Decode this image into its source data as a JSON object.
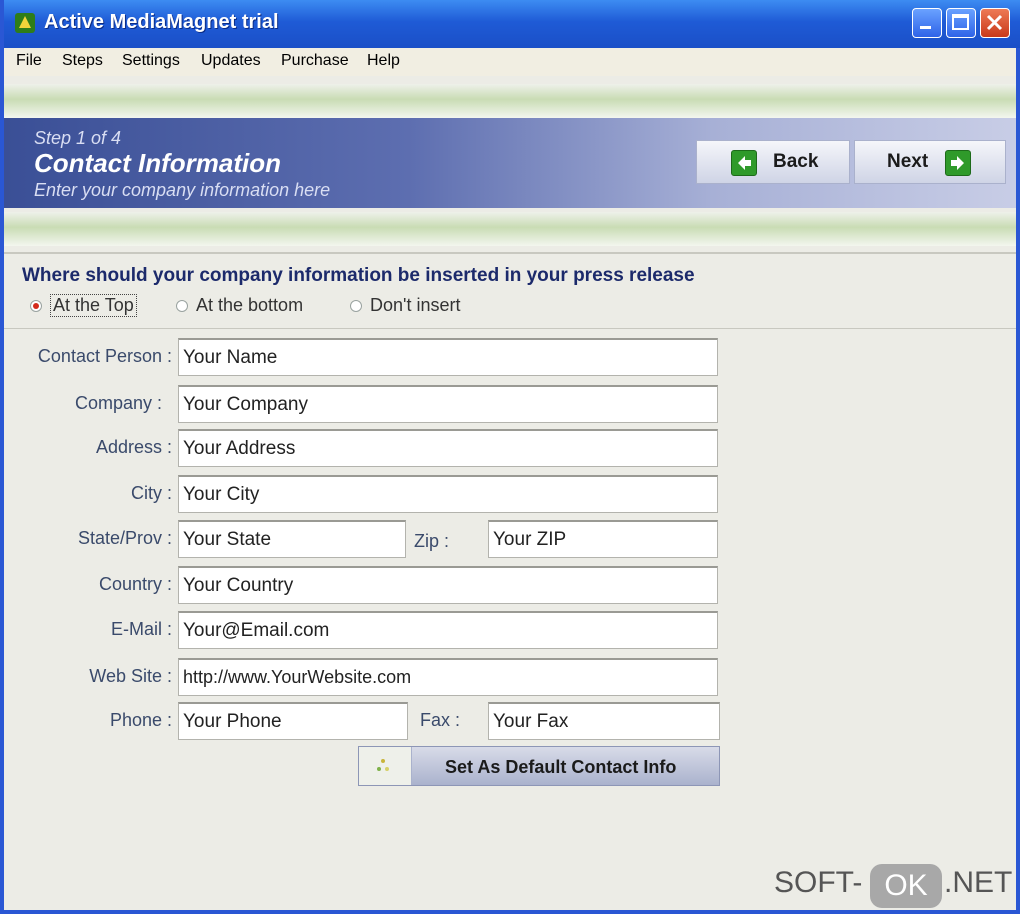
{
  "window": {
    "title": "Active MediaMagnet trial",
    "menu": [
      "File",
      "Steps",
      "Settings",
      "Updates",
      "Purchase",
      "Help"
    ]
  },
  "banner": {
    "step": "Step 1 of 4",
    "title": "Contact Information",
    "subtitle": "Enter your company information here",
    "back_label": "Back",
    "next_label": "Next"
  },
  "placement": {
    "question": "Where should your company information be inserted in your press release",
    "options": [
      "At the Top",
      "At the bottom",
      "Don't insert"
    ],
    "selected": "At the Top"
  },
  "form": {
    "contact_person": {
      "label": "Contact Person :",
      "value": "Your Name"
    },
    "company": {
      "label": "Company :",
      "value": "Your Company"
    },
    "address": {
      "label": "Address :",
      "value": "Your Address"
    },
    "city": {
      "label": "City :",
      "value": "Your City"
    },
    "state": {
      "label": "State/Prov :",
      "value": "Your State"
    },
    "zip": {
      "label": "Zip :",
      "value": "Your ZIP"
    },
    "country": {
      "label": "Country :",
      "value": "Your Country"
    },
    "email": {
      "label": "E-Mail :",
      "value": "Your@Email.com"
    },
    "website": {
      "label": "Web Site :",
      "value": "http://www.YourWebsite.com"
    },
    "phone": {
      "label": "Phone :",
      "value": "Your Phone"
    },
    "fax": {
      "label": "Fax :",
      "value": "Your Fax"
    },
    "default_button": "Set As Default Contact Info"
  },
  "watermark": {
    "left": "SOFT-",
    "badge": "OK",
    "right": ".NET"
  },
  "colors": {
    "titlebar": "#1f5bd6",
    "banner": "#3a4f96",
    "accent_green": "#2f9a2a",
    "radio_selected": "#d42a1c"
  }
}
